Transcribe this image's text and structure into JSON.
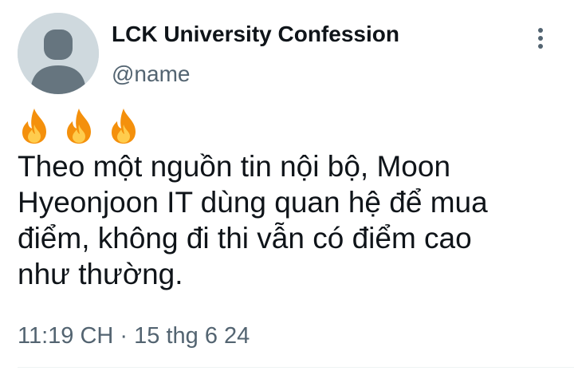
{
  "author": {
    "display_name": "LCK University Confession",
    "handle": "@name",
    "avatar_icon": "default-profile-icon"
  },
  "menu": {
    "icon": "more-vertical-icon"
  },
  "tweet": {
    "emoji": [
      "🔥",
      "🔥",
      "🔥"
    ],
    "text_lines": [
      "Theo một nguồn tin nội bộ, Moon",
      "Hyeonjoon IT dùng quan hệ để mua",
      "điểm, không đi thi vẫn có điểm cao",
      "như thường."
    ],
    "timestamp": "11:19 CH · 15 thg 6 24"
  },
  "colors": {
    "text": "#0f1419",
    "secondary": "#536471",
    "avatar_bg": "#cfd9de",
    "avatar_fg": "#66757f",
    "fire": "#f4900c",
    "fire_inner": "#ffcc4d"
  }
}
